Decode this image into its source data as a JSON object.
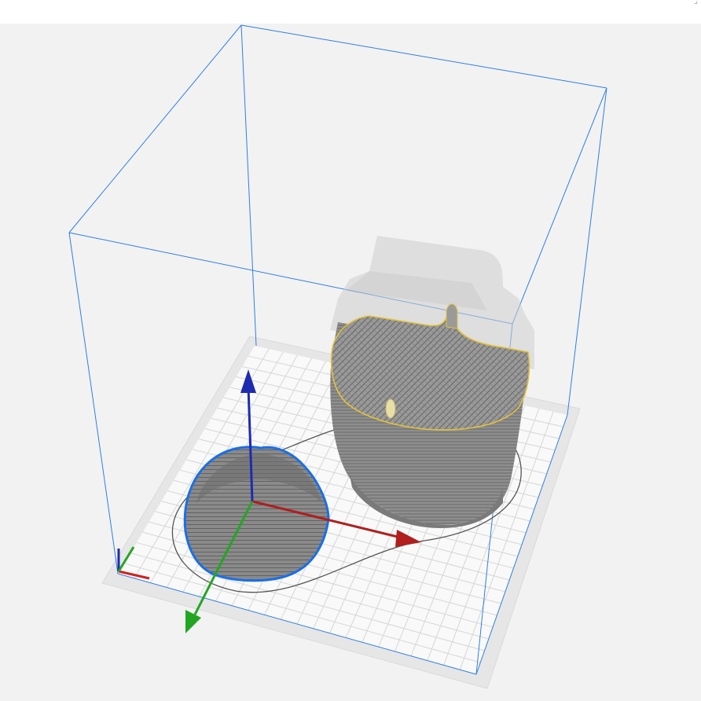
{
  "app": {
    "view": "3d-preview-slice-viewer"
  },
  "colors": {
    "background": "#f2f2f2",
    "build_volume": "#2f7fe0",
    "bed_grid": "#d4d4d4",
    "bed_fill": "#f8f8f8",
    "bed_border": "#e2e2e2",
    "axis_x": "#b01e1e",
    "axis_y": "#22a622",
    "axis_z": "#1e2bb0",
    "selection_outline": "#1a6fe8",
    "layer_highlight": "#e3c23a",
    "sliced_model": "#8a8a8a",
    "ghost_model": "#c8c8c8"
  },
  "scene": {
    "objects": [
      {
        "name": "dome-object",
        "state": "selected"
      },
      {
        "name": "sliced-cup-object",
        "state": "layer-preview"
      }
    ],
    "gizmo": {
      "axes": [
        "x",
        "y",
        "z"
      ]
    }
  }
}
